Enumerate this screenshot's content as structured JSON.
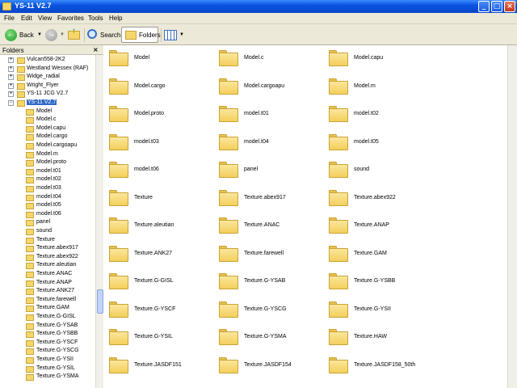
{
  "window": {
    "title": "YS-11 V2.7"
  },
  "menu": [
    "File",
    "Edit",
    "View",
    "Favorites",
    "Tools",
    "Help"
  ],
  "toolbar": {
    "back_label": "Back",
    "search_label": "Search",
    "folders_label": "Folders"
  },
  "folders_pane": {
    "title": "Folders",
    "top_items": [
      {
        "label": "Vulcan558-2K2"
      },
      {
        "label": "Westland Wessex (RAF)"
      },
      {
        "label": "Widge_radial"
      },
      {
        "label": "Wright_Flyer"
      },
      {
        "label": "YS-11 JCG V2.7"
      },
      {
        "label": "YS-11 V2.7"
      }
    ],
    "children": [
      "Model",
      "Model.c",
      "Model.capu",
      "Model.cargo",
      "Model.cargoapu",
      "Model.m",
      "Model.proto",
      "model.t01",
      "model.t02",
      "model.t03",
      "model.t04",
      "model.t05",
      "model.t06",
      "panel",
      "sound",
      "Texture",
      "Texture.abex917",
      "Texture.abex922",
      "Texture.aleutian",
      "Texture.ANAC",
      "Texture.ANAP",
      "Texture.ANK27",
      "Texture.farewell",
      "Texture.GAM",
      "Texture.G-GISL",
      "Texture.G-YSAB",
      "Texture.G-YSBB",
      "Texture.G-YSCF",
      "Texture.G-YSCG",
      "Texture.G-YSII",
      "Texture.G-YSIL",
      "Texture.G-YSMA"
    ]
  },
  "content": {
    "items": [
      "Model",
      "Model.c",
      "Model.capu",
      "Model.cargo",
      "Model.cargoapu",
      "Model.m",
      "Model.proto",
      "model.t01",
      "model.t02",
      "model.t03",
      "model.t04",
      "model.t05",
      "model.t06",
      "panel",
      "sound",
      "Texture",
      "Texture.abex917",
      "Texture.abex922",
      "Texture.aleutian",
      "Texture.ANAC",
      "Texture.ANAP",
      "Texture.ANK27",
      "Texture.farewell",
      "Texture.GAM",
      "Texture.G-GISL",
      "Texture.G-YSAB",
      "Texture.G-YSBB",
      "Texture.G-YSCF",
      "Texture.G-YSCG",
      "Texture.G-YSII",
      "Texture.G-YSIL",
      "Texture.G-YSMA",
      "Texture.HAW",
      "Texture.JASDF151",
      "Texture.JASDF154",
      "Texture.JASDF158_50th"
    ]
  }
}
